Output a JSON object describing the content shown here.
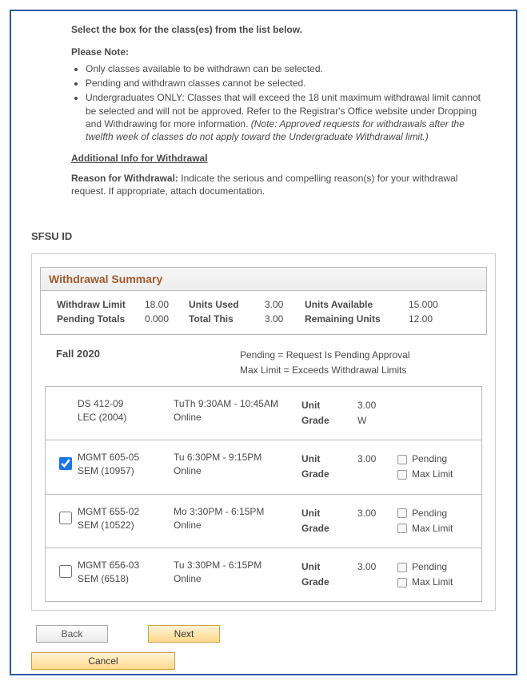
{
  "instructions": {
    "select_line": "Select the box for the class(es) from the list below.",
    "please_note": "Please Note:",
    "bullets": [
      "Only classes available to be withdrawn can be selected.",
      "Pending and withdrawn classes cannot be selected."
    ],
    "bullet3_prefix": "Undergraduates ONLY: Classes that will exceed the 18 unit maximum withdrawal limit cannot be selected and will not be approved.  Refer to the Registrar's Office website under Dropping and Withdrawing for more information. ",
    "bullet3_italic": "(Note: Approved requests for withdrawals after the twelfth week of classes do not apply toward the Undergraduate Withdrawal limit.)",
    "additional_title": "Additional Info for Withdrawal",
    "reason_label": "Reason for Withdrawal:",
    "reason_text": " Indicate the serious and compelling reason(s) for your withdrawal request.  If appropriate, attach documentation."
  },
  "sfsu_id_label": "SFSU ID",
  "summary": {
    "title": "Withdrawal Summary",
    "withdraw_limit_label": "Withdraw Limit",
    "withdraw_limit": "18.00",
    "units_used_label": "Units Used",
    "units_used": "3.00",
    "units_available_label": "Units Available",
    "units_available": "15.000",
    "pending_totals_label": "Pending Totals",
    "pending_totals": "0.000",
    "total_this_label": "Total This",
    "total_this": "3.00",
    "remaining_units_label": "Remaining Units",
    "remaining_units": "12.00"
  },
  "term": "Fall 2020",
  "legend": {
    "pending": "Pending = Request Is Pending Approval",
    "maxlimit": "Max Limit = Exceeds Withdrawal Limits"
  },
  "col_labels": {
    "unit": "Unit",
    "grade": "Grade",
    "pending": "Pending",
    "maxlimit": "Max Limit"
  },
  "classes": [
    {
      "checkbox": false,
      "has_checkbox": false,
      "course": "DS 412-09",
      "section": "LEC (2004)",
      "sched1": "TuTh 9:30AM - 10:45AM",
      "sched2": "Online",
      "units": "3.00",
      "grade": "W",
      "show_flags": false
    },
    {
      "checkbox": true,
      "has_checkbox": true,
      "course": "MGMT 605-05",
      "section": "SEM (10957)",
      "sched1": "Tu 6:30PM - 9:15PM",
      "sched2": "Online",
      "units": "3.00",
      "grade": "",
      "show_flags": true
    },
    {
      "checkbox": false,
      "has_checkbox": true,
      "course": "MGMT 655-02",
      "section": "SEM (10522)",
      "sched1": "Mo 3:30PM - 6:15PM",
      "sched2": "Online",
      "units": "3.00",
      "grade": "",
      "show_flags": true
    },
    {
      "checkbox": false,
      "has_checkbox": true,
      "course": "MGMT 656-03",
      "section": "SEM (6518)",
      "sched1": "Tu 3:30PM - 6:15PM",
      "sched2": "Online",
      "units": "3.00",
      "grade": "",
      "show_flags": true
    }
  ],
  "buttons": {
    "back": "Back",
    "next": "Next",
    "cancel": "Cancel"
  }
}
